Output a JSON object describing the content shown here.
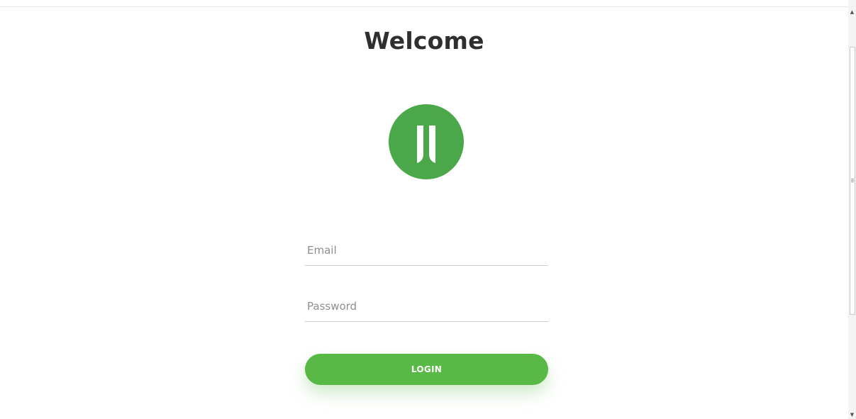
{
  "page": {
    "title": "Welcome"
  },
  "logo": {
    "icon": "brand-logo-icon",
    "color": "#4aa84a"
  },
  "form": {
    "email": {
      "value": "",
      "placeholder": "Email"
    },
    "password": {
      "value": "",
      "placeholder": "Password"
    },
    "login_label": "LOGIN"
  },
  "colors": {
    "accent": "#58b947",
    "title": "#2f2f2f"
  }
}
